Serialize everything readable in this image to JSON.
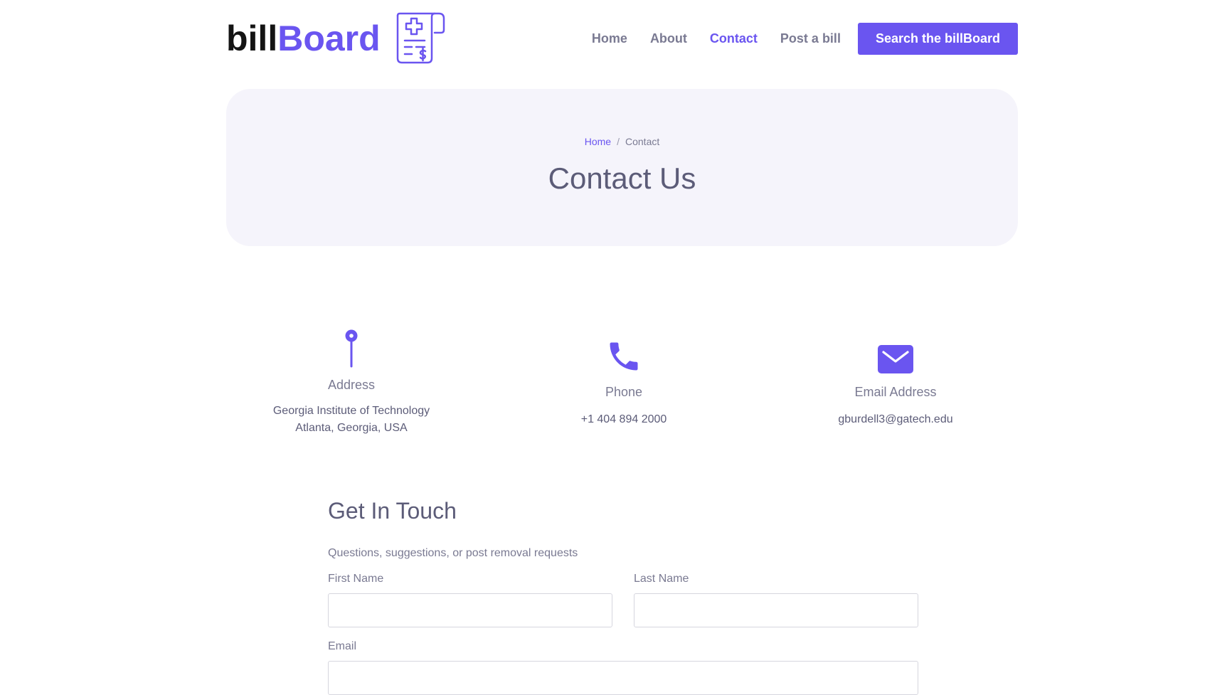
{
  "brand": {
    "name_part1": "bill",
    "name_part2": "Board",
    "logo_icon": "medical-bill-icon",
    "accent_color": "#6a55f0"
  },
  "nav": {
    "items": [
      {
        "label": "Home",
        "active": false
      },
      {
        "label": "About",
        "active": false
      },
      {
        "label": "Contact",
        "active": true
      },
      {
        "label": "Post a bill",
        "active": false
      }
    ],
    "cta_label": "Search the billBoard"
  },
  "hero": {
    "breadcrumb": {
      "home": "Home",
      "separator": "/",
      "current": "Contact"
    },
    "title": "Contact Us"
  },
  "contact_info": {
    "address": {
      "icon": "map-pin-icon",
      "label": "Address",
      "line1": "Georgia Institute of Technology",
      "line2": "Atlanta, Georgia, USA"
    },
    "phone": {
      "icon": "phone-icon",
      "label": "Phone",
      "value": "+1 404 894 2000"
    },
    "email": {
      "icon": "envelope-icon",
      "label": "Email Address",
      "value": "gburdell3@gatech.edu"
    }
  },
  "form": {
    "title": "Get In Touch",
    "subtitle": "Questions, suggestions, or post removal requests",
    "first_name_label": "First Name",
    "first_name_value": "",
    "last_name_label": "Last Name",
    "last_name_value": "",
    "email_label": "Email",
    "email_value": ""
  }
}
